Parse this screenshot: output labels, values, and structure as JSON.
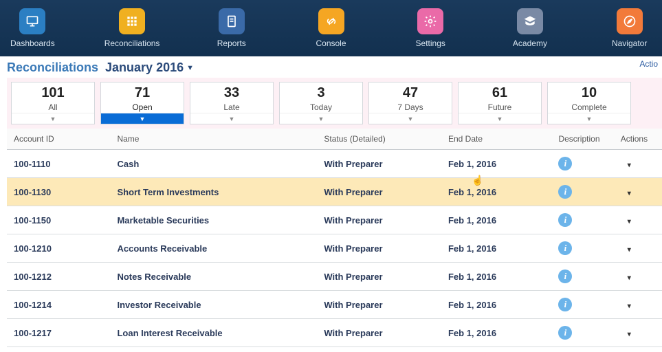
{
  "nav": {
    "items": [
      {
        "label": "Dashboards"
      },
      {
        "label": "Reconciliations"
      },
      {
        "label": "Reports"
      },
      {
        "label": "Console"
      },
      {
        "label": "Settings"
      },
      {
        "label": "Academy"
      },
      {
        "label": "Navigator"
      }
    ]
  },
  "page": {
    "title": "Reconciliations",
    "period": "January 2016",
    "action_link": "Actio"
  },
  "cards": [
    {
      "count": "101",
      "label": "All"
    },
    {
      "count": "71",
      "label": "Open"
    },
    {
      "count": "33",
      "label": "Late"
    },
    {
      "count": "3",
      "label": "Today"
    },
    {
      "count": "47",
      "label": "7 Days"
    },
    {
      "count": "61",
      "label": "Future"
    },
    {
      "count": "10",
      "label": "Complete"
    }
  ],
  "table": {
    "headers": {
      "id": "Account ID",
      "name": "Name",
      "status": "Status (Detailed)",
      "end": "End Date",
      "desc": "Description",
      "act": "Actions"
    },
    "rows": [
      {
        "id": "100-1110",
        "name": "Cash",
        "status": "With Preparer",
        "end": "Feb 1, 2016"
      },
      {
        "id": "100-1130",
        "name": "Short Term Investments",
        "status": "With Preparer",
        "end": "Feb 1, 2016"
      },
      {
        "id": "100-1150",
        "name": "Marketable Securities",
        "status": "With Preparer",
        "end": "Feb 1, 2016"
      },
      {
        "id": "100-1210",
        "name": "Accounts Receivable",
        "status": "With Preparer",
        "end": "Feb 1, 2016"
      },
      {
        "id": "100-1212",
        "name": "Notes Receivable",
        "status": "With Preparer",
        "end": "Feb 1, 2016"
      },
      {
        "id": "100-1214",
        "name": "Investor Receivable",
        "status": "With Preparer",
        "end": "Feb 1, 2016"
      },
      {
        "id": "100-1217",
        "name": "Loan Interest Receivable",
        "status": "With Preparer",
        "end": "Feb 1, 2016"
      }
    ],
    "highlight_index": 1
  },
  "colors": {
    "active_blue": "#0a6cd6",
    "highlight_yellow": "#fde9b8"
  }
}
